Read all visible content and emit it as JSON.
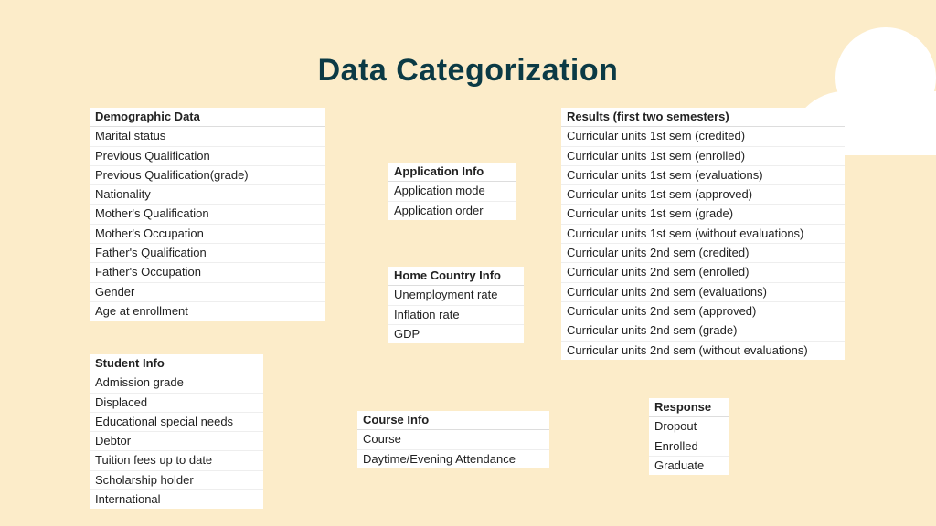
{
  "title": "Data Categorization",
  "demographic": {
    "header": "Demographic Data",
    "items": [
      "Marital status",
      "Previous Qualification",
      "Previous Qualification(grade)",
      "Nationality",
      "Mother's Qualification",
      "Mother's Occupation",
      "Father's Qualification",
      "Father's Occupation",
      "Gender",
      "Age at enrollment"
    ]
  },
  "student_info": {
    "header": "Student Info",
    "items": [
      "Admission grade",
      "Displaced",
      "Educational special needs",
      "Debtor",
      "Tuition fees up to date",
      "Scholarship holder",
      "International"
    ]
  },
  "application": {
    "header": "Application Info",
    "items": [
      "Application mode",
      "Application order"
    ]
  },
  "home_country": {
    "header": "Home Country Info",
    "items": [
      "Unemployment rate",
      "Inflation rate",
      "GDP"
    ]
  },
  "course_info": {
    "header": "Course Info",
    "items": [
      "Course",
      "Daytime/Evening Attendance"
    ]
  },
  "results": {
    "header": "Results (first two semesters)",
    "items": [
      "Curricular units 1st sem (credited)",
      "Curricular units 1st sem (enrolled)",
      "Curricular units 1st sem (evaluations)",
      "Curricular units 1st sem (approved)",
      "Curricular units 1st sem (grade)",
      "Curricular units 1st sem (without evaluations)",
      "Curricular units 2nd sem (credited)",
      "Curricular units 2nd sem (enrolled)",
      "Curricular units 2nd sem (evaluations)",
      "Curricular units 2nd sem (approved)",
      "Curricular units 2nd sem (grade)",
      "Curricular units 2nd sem (without evaluations)"
    ]
  },
  "response": {
    "header": "Response",
    "items": [
      "Dropout",
      "Enrolled",
      "Graduate"
    ]
  }
}
